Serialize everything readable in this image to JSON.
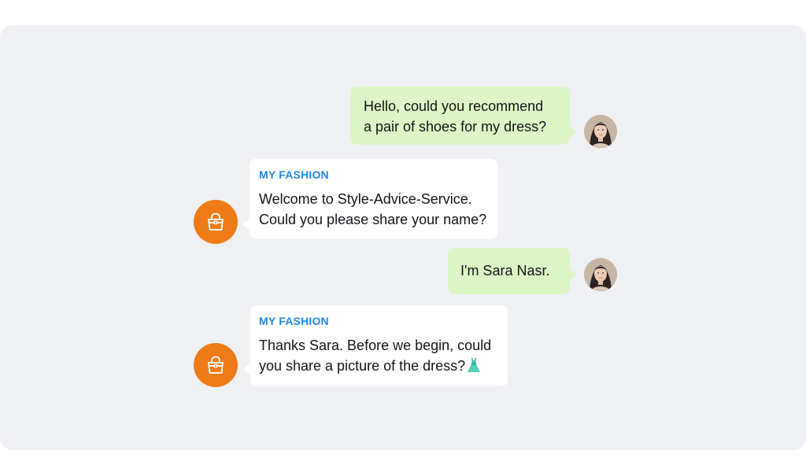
{
  "conversation": {
    "messages": [
      {
        "role": "user",
        "lines": [
          "Hello, could you recommend",
          "a pair of shoes for my dress?"
        ]
      },
      {
        "role": "bot",
        "sender": "MY FASHION",
        "lines": [
          "Welcome to Style-Advice-Service.",
          "Could you please share your name?"
        ]
      },
      {
        "role": "user",
        "lines": [
          "I'm Sara Nasr."
        ]
      },
      {
        "role": "bot",
        "sender": "MY FASHION",
        "lines": [
          "Thanks Sara. Before we begin, could",
          "you share a picture of the dress?"
        ],
        "emoji_icon": "dress-icon"
      }
    ]
  },
  "icons": {
    "bot_avatar": "handbag-icon",
    "user_avatar": "user-photo-avatar"
  },
  "colors": {
    "panel_background": "#f0f1f5",
    "user_bubble": "#dcf7c5",
    "bot_bubble": "#ffffff",
    "sender_label": "#1e88e5",
    "bot_avatar_background": "#ee7b16"
  }
}
